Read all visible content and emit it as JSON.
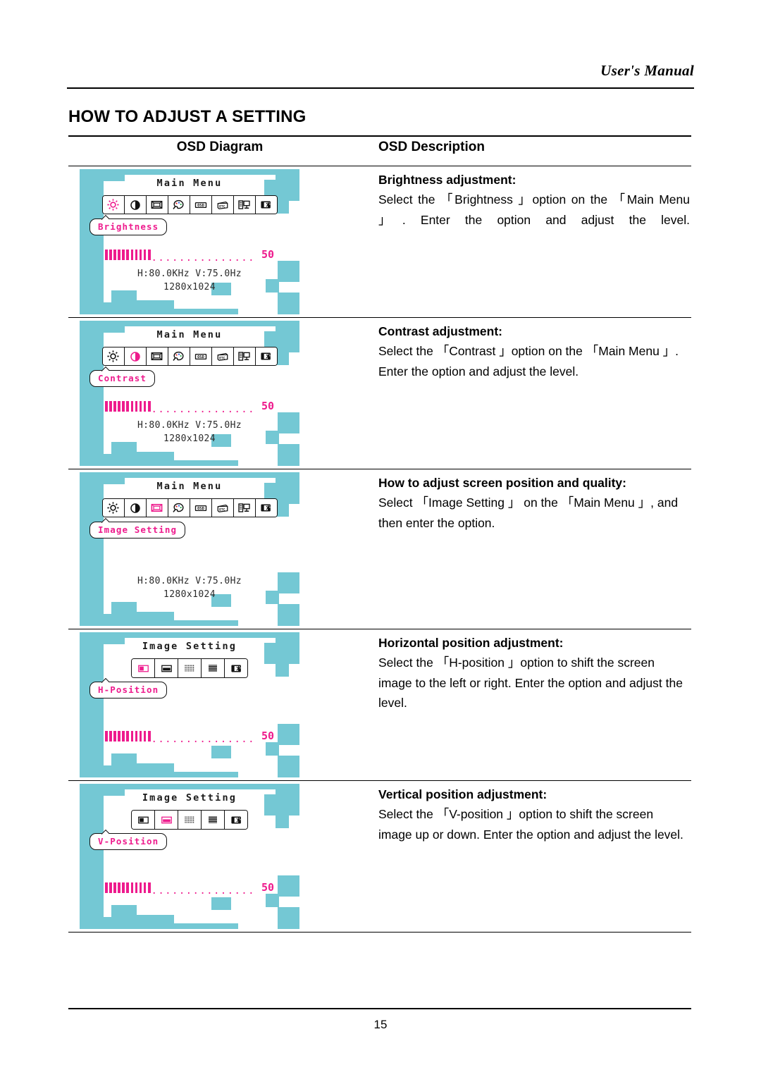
{
  "header": {
    "title": "User's Manual"
  },
  "section": {
    "title": "HOW TO ADJUST A SETTING"
  },
  "table": {
    "col_headers": {
      "diagram": "OSD Diagram",
      "description": "OSD Description"
    }
  },
  "footer": {
    "page_number": "15"
  },
  "colors": {
    "teal": "#74c8d4",
    "magenta": "#ee1b8d",
    "rule": "#000000"
  },
  "osd_common": {
    "main_menu_title": "Main Menu",
    "image_setting_title": "Image Setting",
    "frequency_line": "H:80.0KHz V:75.0Hz",
    "resolution_line": "1280x1024",
    "level_value": "50",
    "level_dots": "...............",
    "level_filled_bars": 11,
    "main_menu_icons": [
      "brightness-icon",
      "contrast-icon",
      "image-setting-icon",
      "color-icon",
      "osd-icon",
      "etc-icon",
      "information-icon",
      "exit-icon"
    ],
    "image_setting_icons": [
      "h-position-icon",
      "v-position-icon",
      "clock-icon",
      "phase-icon",
      "exit-icon"
    ]
  },
  "rows": [
    {
      "id": "brightness",
      "osd": {
        "title": "Main Menu",
        "menu": "main",
        "selected_index": 0,
        "bubble_label": "Brightness",
        "has_level": true,
        "level_value": "50",
        "has_freq": true
      },
      "desc": {
        "title": "Brightness adjustment:",
        "body": "Select the 「Brightness 」option on the 「Main Menu 」. Enter the option and adjust the level."
      }
    },
    {
      "id": "contrast",
      "osd": {
        "title": "Main Menu",
        "menu": "main",
        "selected_index": 1,
        "bubble_label": "Contrast",
        "has_level": true,
        "level_value": "50",
        "has_freq": true
      },
      "desc": {
        "title": "Contrast adjustment:",
        "body": "Select the 「Contrast 」option on the 「Main Menu 」. Enter the option and adjust the level."
      }
    },
    {
      "id": "image-setting",
      "osd": {
        "title": "Main Menu",
        "menu": "main",
        "selected_index": 2,
        "bubble_label": "Image Setting",
        "has_level": false,
        "level_value": "",
        "has_freq": true
      },
      "desc": {
        "title": "How to adjust screen position and quality:",
        "body": "Select 「Image Setting 」 on the 「Main Menu 」, and then enter the option."
      }
    },
    {
      "id": "h-position",
      "osd": {
        "title": "Image Setting",
        "menu": "sub",
        "selected_index": 0,
        "bubble_label": "H-Position",
        "has_level": true,
        "level_value": "50",
        "has_freq": false
      },
      "desc": {
        "title": "Horizontal position adjustment:",
        "body": "Select the 「H-position 」option to shift the screen image to the left or right. Enter the option and adjust the level."
      }
    },
    {
      "id": "v-position",
      "osd": {
        "title": "Image Setting",
        "menu": "sub",
        "selected_index": 1,
        "bubble_label": "V-Position",
        "has_level": true,
        "level_value": "50",
        "has_freq": false
      },
      "desc": {
        "title": "Vertical position adjustment:",
        "body": "Select the 「V-position 」option to shift the screen image up or down. Enter the option and adjust the level."
      }
    }
  ]
}
